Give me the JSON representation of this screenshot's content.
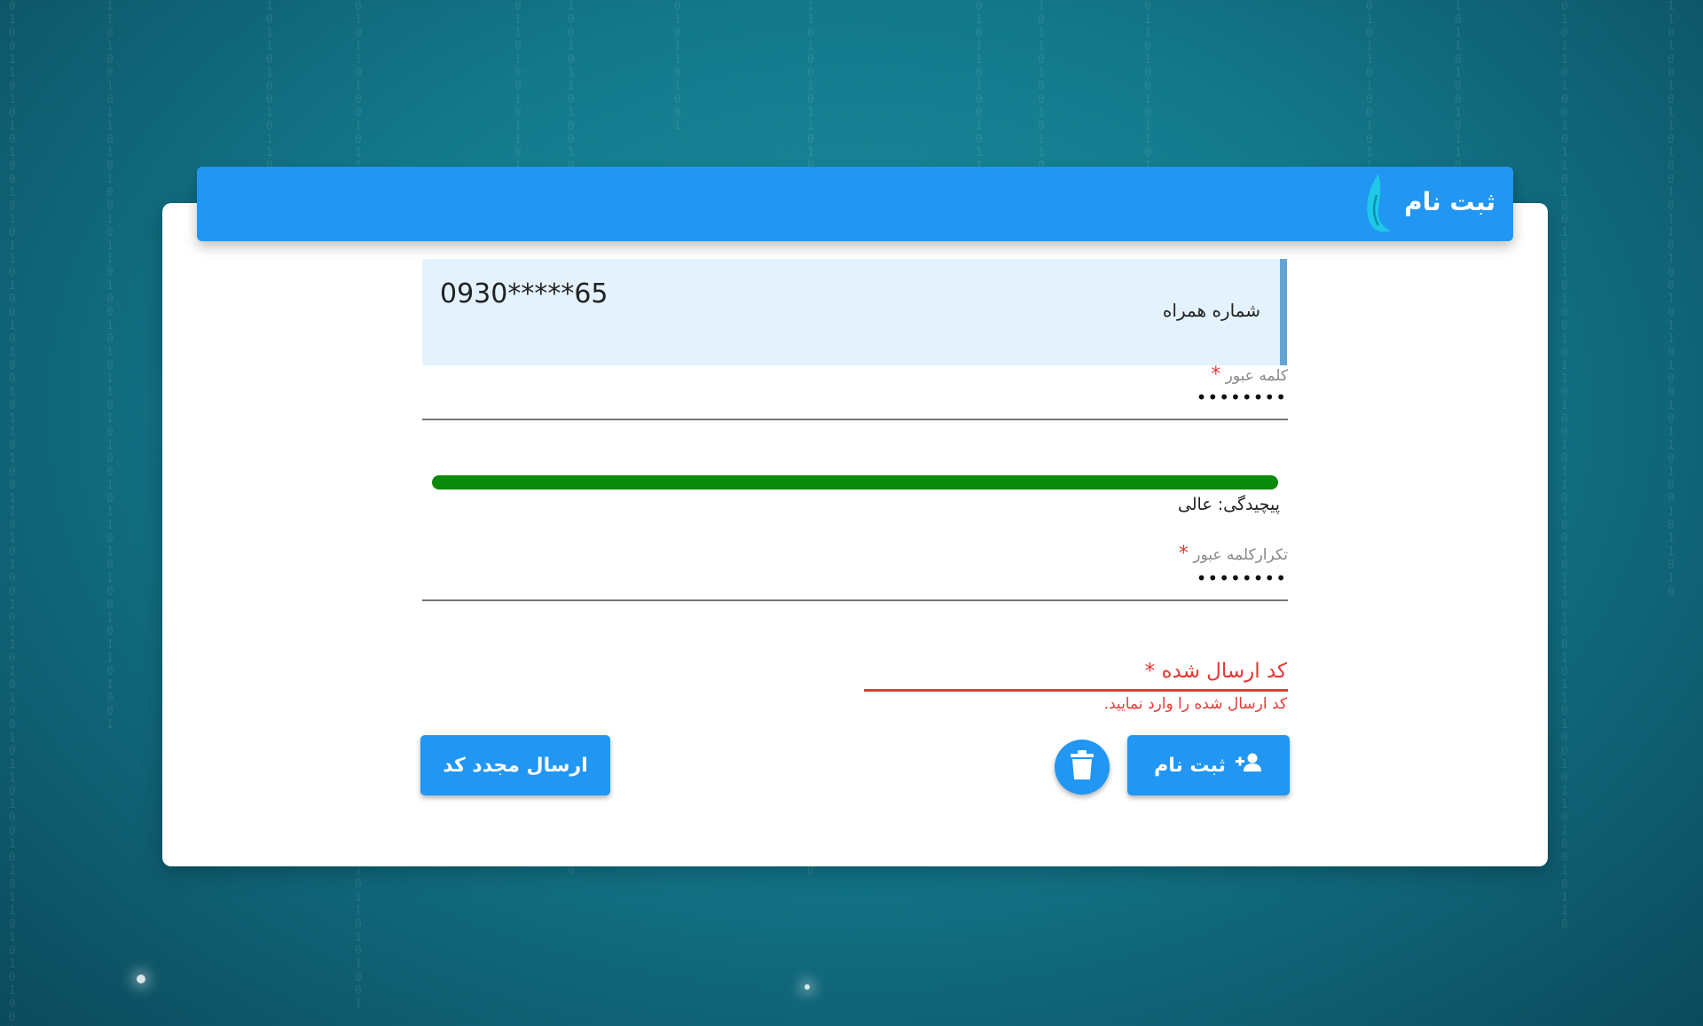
{
  "header": {
    "title": "ثبت نام",
    "logo_icon": "feather-logo-icon"
  },
  "form": {
    "phone": {
      "label": "شماره همراه",
      "value": "0930*****65"
    },
    "password": {
      "label": "کلمه عبور",
      "required_mark": "*",
      "value_masked": "••••••••"
    },
    "strength": {
      "level_fraction": 1.0,
      "color": "#0a8a0a",
      "text": "پیچیدگی: عالی"
    },
    "password_repeat": {
      "label": "تکرارکلمه عبور",
      "required_mark": "*",
      "value_masked": "••••••••"
    },
    "code": {
      "label": "کد ارسال شده",
      "required_mark": "*",
      "error": "کد ارسال شده را وارد نمایید."
    }
  },
  "buttons": {
    "register_label": "ثبت نام",
    "register_icon": "user-plus-icon",
    "delete_icon": "trash-icon",
    "resend_label": "ارسال مجدد کد"
  },
  "colors": {
    "accent": "#2196f3",
    "error": "#e53935"
  }
}
